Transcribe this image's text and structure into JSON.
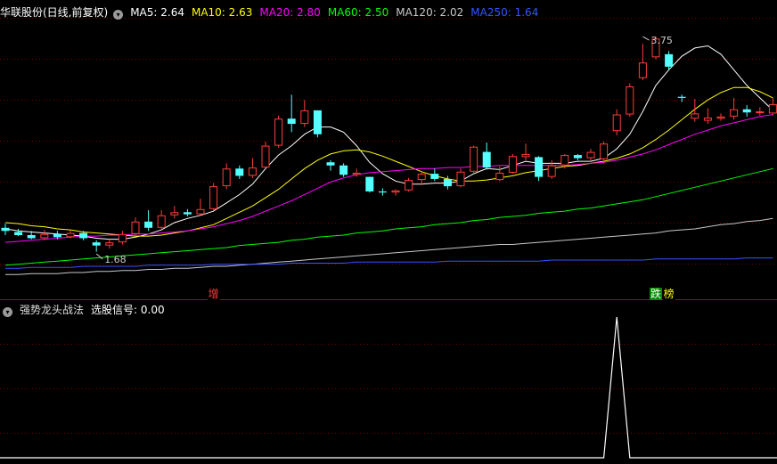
{
  "main_header": {
    "stock_name": "华联股份(日线,前复权)",
    "ma": [
      {
        "label": "MA5: 2.64",
        "color": "#ffffff"
      },
      {
        "label": "MA10: 2.63",
        "color": "#ffff00"
      },
      {
        "label": "MA20: 2.80",
        "color": "#ff00ff"
      },
      {
        "label": "MA60: 2.50",
        "color": "#00ff00"
      },
      {
        "label": "MA120: 2.02",
        "color": "#c8c8c8"
      },
      {
        "label": "MA250: 1.64",
        "color": "#3355ff"
      }
    ]
  },
  "indicator_header": {
    "name": "强势龙头战法",
    "signal_label": "选股信号: 0.00"
  },
  "tags": [
    {
      "text": "增",
      "bg": "#000000",
      "color": "#ff3b3b",
      "bar": 16
    },
    {
      "text": "跌",
      "bg": "#008800",
      "color": "#ffffff",
      "bar": 50
    },
    {
      "text": "榜",
      "bg": "#000000",
      "color": "#ffff00",
      "bar": 51
    }
  ],
  "chart_data": {
    "type": "candlestick",
    "price_range": [
      1.38,
      3.95
    ],
    "up_color": "#ff3b3b",
    "down_color": "#54ffff",
    "annotations": [
      {
        "text": "1.68",
        "bar": 7,
        "price": 1.68
      },
      {
        "text": "3.75",
        "bar": 49,
        "price": 3.77
      }
    ],
    "candles": [
      [
        1.93,
        1.9,
        1.97,
        1.86
      ],
      [
        1.89,
        1.86,
        1.92,
        1.85
      ],
      [
        1.86,
        1.83,
        1.9,
        1.82
      ],
      [
        1.83,
        1.87,
        1.91,
        1.81
      ],
      [
        1.87,
        1.84,
        1.9,
        1.82
      ],
      [
        1.84,
        1.88,
        1.91,
        1.83
      ],
      [
        1.88,
        1.83,
        1.9,
        1.81
      ],
      [
        1.79,
        1.76,
        1.81,
        1.7
      ],
      [
        1.76,
        1.79,
        1.82,
        1.73
      ],
      [
        1.79,
        1.87,
        1.9,
        1.77
      ],
      [
        1.87,
        1.99,
        2.03,
        1.85
      ],
      [
        1.99,
        1.93,
        2.1,
        1.9
      ],
      [
        1.93,
        2.05,
        2.1,
        1.92
      ],
      [
        2.05,
        2.08,
        2.14,
        2.02
      ],
      [
        2.08,
        2.06,
        2.11,
        2.04
      ],
      [
        2.06,
        2.11,
        2.21,
        2.05
      ],
      [
        2.11,
        2.33,
        2.36,
        2.1
      ],
      [
        2.33,
        2.5,
        2.55,
        2.3
      ],
      [
        2.5,
        2.43,
        2.53,
        2.4
      ],
      [
        2.43,
        2.51,
        2.6,
        2.41
      ],
      [
        2.51,
        2.72,
        2.76,
        2.5
      ],
      [
        2.72,
        2.98,
        3.01,
        2.7
      ],
      [
        2.98,
        2.93,
        3.21,
        2.85
      ],
      [
        2.93,
        3.06,
        3.16,
        2.9
      ],
      [
        3.06,
        2.83,
        3.06,
        2.8
      ],
      [
        2.56,
        2.53,
        2.58,
        2.48
      ],
      [
        2.53,
        2.44,
        2.55,
        2.42
      ],
      [
        2.44,
        2.46,
        2.5,
        2.42
      ],
      [
        2.42,
        2.28,
        2.42,
        2.27
      ],
      [
        2.28,
        2.27,
        2.31,
        2.24
      ],
      [
        2.27,
        2.29,
        2.3,
        2.24
      ],
      [
        2.29,
        2.39,
        2.41,
        2.28
      ],
      [
        2.39,
        2.45,
        2.47,
        2.34
      ],
      [
        2.45,
        2.4,
        2.5,
        2.38
      ],
      [
        2.4,
        2.33,
        2.43,
        2.3
      ],
      [
        2.33,
        2.47,
        2.5,
        2.32
      ],
      [
        2.47,
        2.71,
        2.72,
        2.45
      ],
      [
        2.66,
        2.51,
        2.75,
        2.49
      ],
      [
        2.39,
        2.46,
        2.52,
        2.38
      ],
      [
        2.46,
        2.62,
        2.64,
        2.45
      ],
      [
        2.61,
        2.64,
        2.74,
        2.58
      ],
      [
        2.61,
        2.42,
        2.62,
        2.38
      ],
      [
        2.42,
        2.53,
        2.58,
        2.4
      ],
      [
        2.53,
        2.63,
        2.64,
        2.5
      ],
      [
        2.63,
        2.6,
        2.64,
        2.58
      ],
      [
        2.6,
        2.66,
        2.69,
        2.58
      ],
      [
        2.59,
        2.74,
        2.76,
        2.55
      ],
      [
        2.86,
        3.02,
        3.07,
        2.82
      ],
      [
        3.02,
        3.29,
        3.32,
        3.0
      ],
      [
        3.37,
        3.52,
        3.7,
        3.35
      ],
      [
        3.57,
        3.75,
        3.77,
        3.55
      ],
      [
        3.6,
        3.48,
        3.63,
        3.45
      ],
      [
        3.19,
        3.18,
        3.21,
        3.14
      ],
      [
        2.98,
        3.03,
        3.17,
        2.95
      ],
      [
        2.96,
        2.99,
        3.08,
        2.93
      ],
      [
        2.98,
        3.0,
        3.03,
        2.96
      ],
      [
        3.0,
        3.07,
        3.18,
        2.97
      ],
      [
        3.07,
        3.04,
        3.11,
        3.0
      ],
      [
        3.04,
        3.05,
        3.09,
        3.01
      ],
      [
        3.03,
        3.12,
        3.18,
        3.01
      ]
    ],
    "ma_series": [
      {
        "name": "MA5",
        "color": "#ffffff",
        "values": [
          1.92,
          1.9,
          1.89,
          1.88,
          1.87,
          1.86,
          1.85,
          1.83,
          1.82,
          1.82,
          1.84,
          1.87,
          1.91,
          1.98,
          2.02,
          2.05,
          2.09,
          2.17,
          2.25,
          2.35,
          2.5,
          2.63,
          2.72,
          2.83,
          2.9,
          2.9,
          2.85,
          2.72,
          2.56,
          2.45,
          2.38,
          2.35,
          2.35,
          2.36,
          2.36,
          2.38,
          2.45,
          2.5,
          2.49,
          2.53,
          2.57,
          2.55,
          2.55,
          2.55,
          2.57,
          2.57,
          2.6,
          2.69,
          2.83,
          3.05,
          3.3,
          3.45,
          3.58,
          3.66,
          3.68,
          3.6,
          3.45,
          3.3,
          3.18,
          3.06
        ]
      },
      {
        "name": "MA10",
        "color": "#ffff00",
        "values": [
          1.98,
          1.97,
          1.95,
          1.94,
          1.92,
          1.91,
          1.89,
          1.88,
          1.87,
          1.86,
          1.85,
          1.85,
          1.86,
          1.88,
          1.9,
          1.93,
          1.96,
          2.02,
          2.08,
          2.14,
          2.22,
          2.3,
          2.4,
          2.5,
          2.58,
          2.64,
          2.67,
          2.68,
          2.66,
          2.62,
          2.57,
          2.52,
          2.47,
          2.43,
          2.4,
          2.38,
          2.38,
          2.39,
          2.41,
          2.43,
          2.46,
          2.48,
          2.5,
          2.52,
          2.53,
          2.55,
          2.57,
          2.6,
          2.64,
          2.7,
          2.78,
          2.87,
          2.97,
          3.07,
          3.16,
          3.23,
          3.28,
          3.28,
          3.24,
          3.18
        ]
      },
      {
        "name": "MA20",
        "color": "#ff00ff",
        "values": [
          1.79,
          1.8,
          1.81,
          1.82,
          1.83,
          1.84,
          1.85,
          1.85,
          1.86,
          1.86,
          1.87,
          1.87,
          1.88,
          1.89,
          1.9,
          1.92,
          1.94,
          1.97,
          2.0,
          2.04,
          2.09,
          2.14,
          2.19,
          2.25,
          2.31,
          2.37,
          2.41,
          2.44,
          2.46,
          2.47,
          2.48,
          2.49,
          2.5,
          2.5,
          2.51,
          2.51,
          2.52,
          2.52,
          2.53,
          2.53,
          2.53,
          2.53,
          2.53,
          2.53,
          2.54,
          2.55,
          2.56,
          2.58,
          2.61,
          2.64,
          2.68,
          2.73,
          2.78,
          2.83,
          2.87,
          2.91,
          2.94,
          2.97,
          3.0,
          3.02
        ]
      },
      {
        "name": "MA60",
        "color": "#00ff00",
        "values": [
          1.57,
          1.58,
          1.59,
          1.6,
          1.61,
          1.62,
          1.63,
          1.64,
          1.65,
          1.66,
          1.67,
          1.68,
          1.69,
          1.7,
          1.71,
          1.72,
          1.73,
          1.74,
          1.76,
          1.77,
          1.78,
          1.79,
          1.81,
          1.82,
          1.84,
          1.85,
          1.86,
          1.88,
          1.89,
          1.9,
          1.92,
          1.93,
          1.94,
          1.96,
          1.97,
          1.98,
          2.0,
          2.01,
          2.03,
          2.04,
          2.05,
          2.07,
          2.08,
          2.09,
          2.11,
          2.12,
          2.14,
          2.16,
          2.18,
          2.2,
          2.23,
          2.26,
          2.29,
          2.32,
          2.35,
          2.38,
          2.41,
          2.44,
          2.47,
          2.5
        ]
      },
      {
        "name": "MA120",
        "color": "#c8c8c8",
        "values": [
          1.48,
          1.48,
          1.49,
          1.49,
          1.49,
          1.5,
          1.5,
          1.51,
          1.51,
          1.52,
          1.52,
          1.53,
          1.53,
          1.54,
          1.54,
          1.55,
          1.56,
          1.56,
          1.57,
          1.58,
          1.59,
          1.6,
          1.61,
          1.62,
          1.63,
          1.64,
          1.65,
          1.66,
          1.67,
          1.68,
          1.69,
          1.7,
          1.71,
          1.72,
          1.73,
          1.74,
          1.75,
          1.76,
          1.77,
          1.77,
          1.78,
          1.79,
          1.8,
          1.81,
          1.82,
          1.83,
          1.84,
          1.85,
          1.86,
          1.87,
          1.88,
          1.9,
          1.91,
          1.92,
          1.94,
          1.96,
          1.97,
          1.99,
          2.0,
          2.02
        ]
      },
      {
        "name": "MA250",
        "color": "#3355ff",
        "values": [
          1.54,
          1.54,
          1.55,
          1.55,
          1.55,
          1.55,
          1.56,
          1.56,
          1.56,
          1.56,
          1.56,
          1.57,
          1.57,
          1.57,
          1.57,
          1.57,
          1.58,
          1.58,
          1.58,
          1.58,
          1.58,
          1.58,
          1.59,
          1.59,
          1.59,
          1.59,
          1.59,
          1.6,
          1.6,
          1.6,
          1.6,
          1.6,
          1.6,
          1.6,
          1.61,
          1.61,
          1.61,
          1.61,
          1.61,
          1.61,
          1.61,
          1.61,
          1.62,
          1.62,
          1.62,
          1.62,
          1.62,
          1.62,
          1.62,
          1.62,
          1.63,
          1.63,
          1.63,
          1.63,
          1.63,
          1.63,
          1.63,
          1.64,
          1.64,
          1.64
        ]
      }
    ],
    "signal": {
      "name": "选股信号",
      "color": "#ffffff",
      "range": [
        0,
        1
      ],
      "values": [
        0,
        0,
        0,
        0,
        0,
        0,
        0,
        0,
        0,
        0,
        0,
        0,
        0,
        0,
        0,
        0,
        0,
        0,
        0,
        0,
        0,
        0,
        0,
        0,
        0,
        0,
        0,
        0,
        0,
        0,
        0,
        0,
        0,
        0,
        0,
        0,
        0,
        0,
        0,
        0,
        0,
        0,
        0,
        0,
        0,
        0,
        0,
        1,
        0,
        0,
        0,
        0,
        0,
        0,
        0,
        0,
        0,
        0,
        0,
        0
      ]
    }
  }
}
